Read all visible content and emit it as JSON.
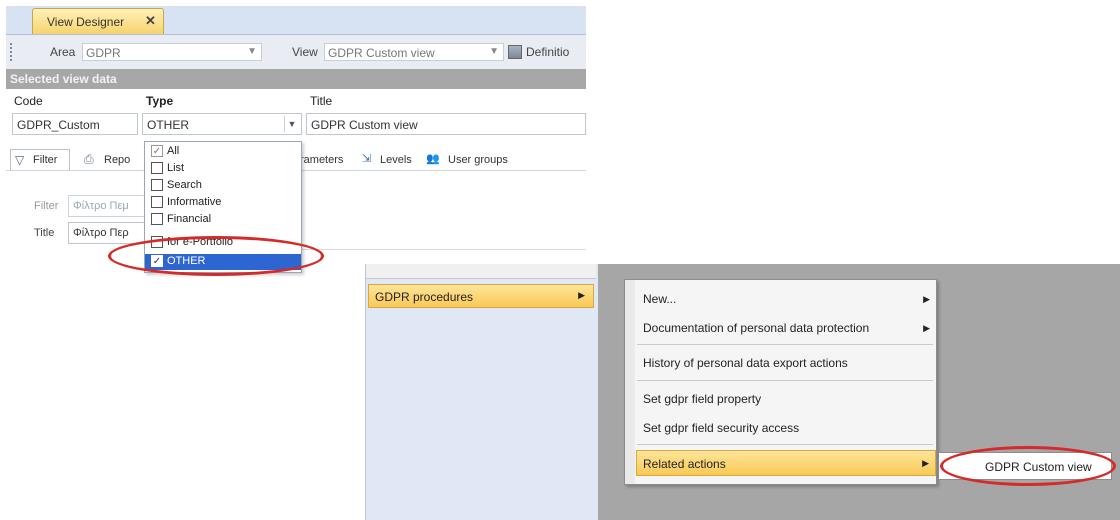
{
  "designer": {
    "tab_label": "View Designer",
    "tab_close": "✕",
    "toolbar": {
      "area_label": "Area",
      "area_value": "GDPR",
      "view_label": "View",
      "view_value": "GDPR Custom view",
      "definition_label": "Definitio"
    },
    "section_header": "Selected view data",
    "fields": {
      "code_label": "Code",
      "code_value": "GDPR_Custom",
      "type_label": "Type",
      "type_value": "OTHER",
      "title_label": "Title",
      "title_value": "GDPR Custom view"
    },
    "subtabs": {
      "filter": "Filter",
      "reports": "Repo",
      "parameters": "rameters",
      "levels": "Levels",
      "user_groups": "User groups"
    },
    "filter_label": "Filter",
    "filter_value": "Φίλτρο Πεμ",
    "title_row_label": "Title",
    "title_row_value": "Φίλτρο Περ",
    "type_options": [
      {
        "label": "All",
        "checked": true
      },
      {
        "label": "List",
        "checked": false
      },
      {
        "label": "Search",
        "checked": false
      },
      {
        "label": "Informative",
        "checked": false
      },
      {
        "label": "Financial",
        "checked": false
      },
      {
        "label": "for e-Portfolio",
        "checked": false
      },
      {
        "label": "OTHER",
        "checked": true,
        "selected": true
      }
    ]
  },
  "context_menu": {
    "main_item": "GDPR procedures",
    "submenu": [
      {
        "label": "New...",
        "has_arrow": true
      },
      {
        "label": "Documentation of personal data protection",
        "has_arrow": true
      },
      {
        "label": "History of personal data export actions",
        "has_arrow": false
      },
      {
        "label": "Set gdpr field property",
        "has_arrow": false
      },
      {
        "label": "Set gdpr field security access",
        "has_arrow": false
      },
      {
        "label": "Related actions",
        "has_arrow": true
      }
    ],
    "related_submenu_item": "GDPR Custom view"
  },
  "colors": {
    "highlight_yellow": "#f9c955",
    "selection_blue": "#2e66d1",
    "annotation_red": "#d62a2a",
    "menu_backdrop_gray": "#a6a6a6"
  },
  "icons": [
    "close-icon",
    "toolbar-grip-icon",
    "dropdown-arrow-icon",
    "definition-icon",
    "funnel-icon",
    "printer-icon",
    "levels-icon",
    "user-groups-icon",
    "checkbox-icon",
    "submenu-arrow-icon"
  ]
}
